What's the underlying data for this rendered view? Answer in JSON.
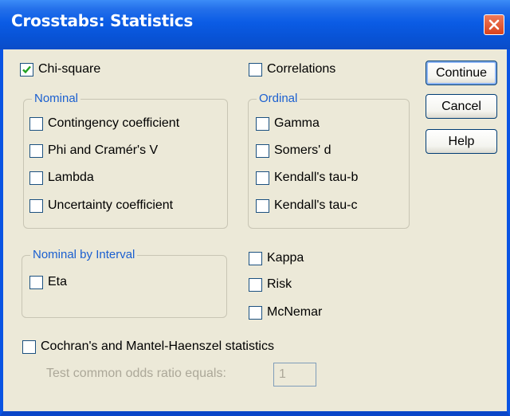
{
  "window": {
    "title": "Crosstabs: Statistics"
  },
  "buttons": {
    "continue": "Continue",
    "cancel": "Cancel",
    "help": "Help"
  },
  "chi_square": {
    "label": "Chi-square",
    "checked": true
  },
  "correlations": {
    "label": "Correlations",
    "checked": false
  },
  "nominal": {
    "legend": "Nominal",
    "items": [
      {
        "label": "Contingency coefficient",
        "checked": false
      },
      {
        "label": "Phi and Cramér's V",
        "checked": false
      },
      {
        "label": "Lambda",
        "checked": false
      },
      {
        "label": "Uncertainty coefficient",
        "checked": false
      }
    ]
  },
  "ordinal": {
    "legend": "Ordinal",
    "items": [
      {
        "label": "Gamma",
        "checked": false
      },
      {
        "label": "Somers' d",
        "checked": false
      },
      {
        "label": "Kendall's tau-b",
        "checked": false
      },
      {
        "label": "Kendall's tau-c",
        "checked": false
      }
    ]
  },
  "nominal_by_interval": {
    "legend": "Nominal by Interval",
    "items": [
      {
        "label": "Eta",
        "checked": false
      }
    ]
  },
  "other": {
    "items": [
      {
        "label": "Kappa",
        "checked": false
      },
      {
        "label": "Risk",
        "checked": false
      },
      {
        "label": "McNemar",
        "checked": false
      }
    ]
  },
  "cochran": {
    "label": "Cochran's and Mantel-Haenszel statistics",
    "checked": false
  },
  "odds": {
    "label": "Test common odds ratio equals:",
    "value": "1",
    "enabled": false
  },
  "colors": {
    "titlebar": "#0a54e3",
    "dialog_bg": "#ece9d8",
    "legend_text": "#1a5fd0",
    "check": "#21a121"
  }
}
